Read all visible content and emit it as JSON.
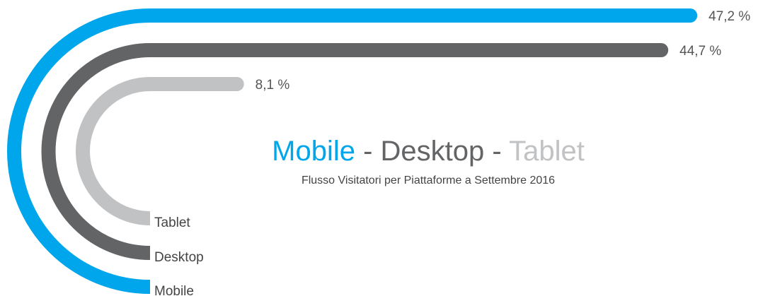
{
  "colors": {
    "mobile": "#00a6eb",
    "desktop": "#636466",
    "tablet": "#c1c2c4"
  },
  "title": {
    "mobile": "Mobile",
    "sep1": " - ",
    "desktop": "Desktop",
    "sep2": "  - ",
    "tablet": "Tablet"
  },
  "subtitle": "Flusso Visitatori per Piattaforme a Settembre 2016",
  "chart_data": {
    "type": "bar",
    "categories": [
      "Mobile",
      "Desktop",
      "Tablet"
    ],
    "values": [
      47.2,
      44.7,
      8.1
    ],
    "value_labels": [
      "47,2 %",
      "44,7 %",
      "8,1 %"
    ],
    "unit": "%",
    "orientation": "horizontal",
    "style": "radial-bar"
  }
}
